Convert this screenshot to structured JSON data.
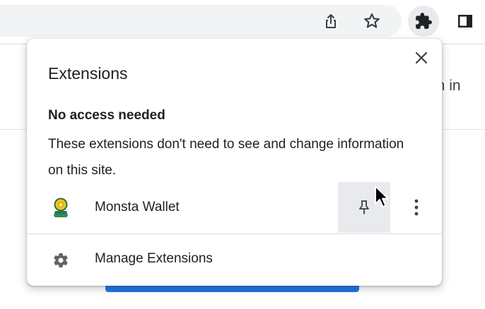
{
  "browser": {
    "toolbar": {
      "icons": [
        "share-icon",
        "star-icon",
        "extensions-puzzle-icon",
        "side-panel-icon"
      ]
    },
    "page": {
      "signin_text": "gn in"
    }
  },
  "popup": {
    "title": "Extensions",
    "close_icon": "close-icon",
    "section": {
      "title": "No access needed",
      "description": "These extensions don't need to see and change information on this site."
    },
    "extensions": [
      {
        "name": "Monsta Wallet",
        "icon": "monsta-wallet-icon",
        "pin_icon": "pin-icon",
        "more_icon": "more-vert-icon"
      }
    ],
    "manage": {
      "label": "Manage Extensions",
      "icon": "gear-icon"
    }
  },
  "colors": {
    "accent_blue": "#1a73e8",
    "hover_gray": "#e8eaed",
    "icon_gray": "#5f6368"
  }
}
